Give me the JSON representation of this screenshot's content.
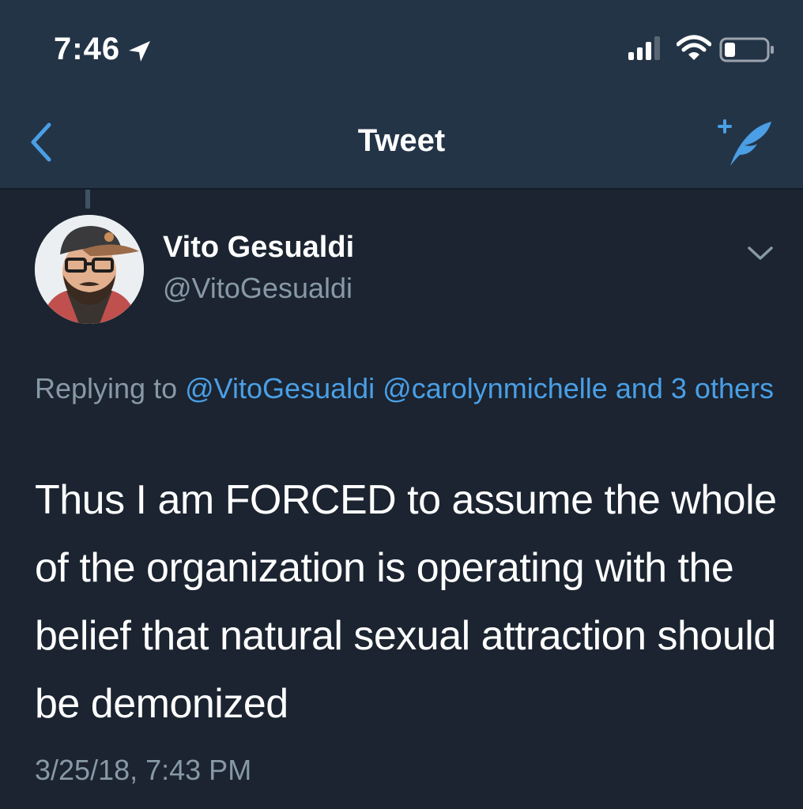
{
  "status_bar": {
    "time": "7:46",
    "icons": [
      "location-arrow-icon",
      "signal-icon",
      "wifi-icon",
      "battery-icon"
    ]
  },
  "nav": {
    "title": "Tweet",
    "back_icon": "chevron-left-icon",
    "compose_icon": "compose-feather-icon"
  },
  "tweet": {
    "display_name": "Vito Gesualdi",
    "handle": "@VitoGesualdi",
    "replying_prefix": "Replying to",
    "replying_mentions": [
      "@VitoGesualdi",
      "@carolynmichelle"
    ],
    "replying_others": "and 3 others",
    "text": "Thus I am FORCED to assume the whole of the organization is operating with the belief that natural sexual attraction should be demonized",
    "timestamp": "3/25/18, 7:43 PM"
  },
  "colors": {
    "background": "#1b2430",
    "header": "#243447",
    "accent": "#4a9fe6",
    "secondary_text": "#8899a6"
  }
}
